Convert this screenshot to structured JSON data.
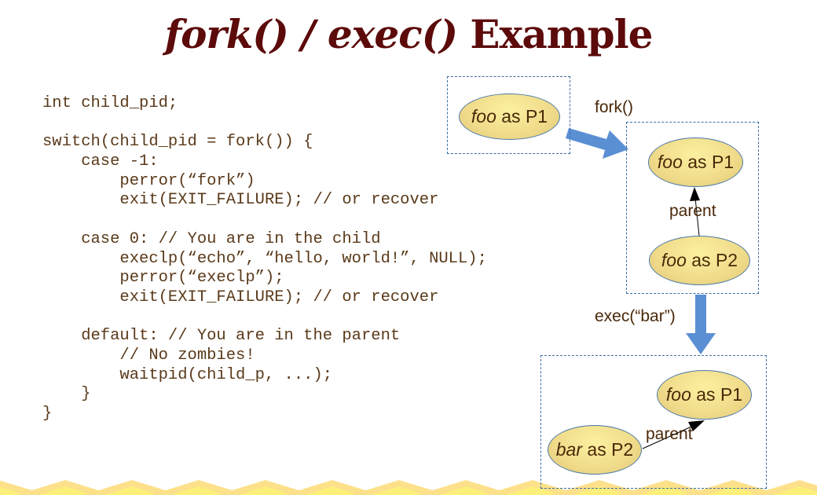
{
  "title": {
    "italic_part": "fork() / exec()",
    "regular_part": " Example"
  },
  "code_lines": [
    "int child_pid;",
    "",
    "switch(child_pid = fork()) {",
    "    case -1:",
    "        perror(“fork”)",
    "        exit(EXIT_FAILURE); // or recover",
    "",
    "    case 0: // You are in the child",
    "        execlp(“echo”, “hello, world!”, NULL);",
    "        perror(“execlp”);",
    "        exit(EXIT_FAILURE); // or recover",
    "",
    "    default: // You are in the parent",
    "        // No zombies!",
    "        waitpid(child_p, ...);",
    "    }",
    "}"
  ],
  "diagram": {
    "stage1": {
      "node": {
        "prog": "foo",
        "rest": " as P1"
      }
    },
    "fork_label": "fork()",
    "stage2": {
      "parent_node": {
        "prog": "foo",
        "rest": " as P1"
      },
      "child_node": {
        "prog": "foo",
        "rest": " as P2"
      },
      "edge_label": "parent"
    },
    "exec_label": "exec(“bar”)",
    "stage3": {
      "parent_node": {
        "prog": "foo",
        "rest": " as P1"
      },
      "child_node": {
        "prog": "bar",
        "rest": " as P2"
      },
      "edge_label": "parent"
    }
  },
  "colors": {
    "title": "#5c0a0a",
    "code_text": "#5a3a1a",
    "arrow_blue": "#5b8fd4",
    "box_border": "#3a6ea5",
    "node_fill": "#efdb8a",
    "zigzag_outer": "#fde08a",
    "zigzag_inner": "#fdf07a"
  }
}
